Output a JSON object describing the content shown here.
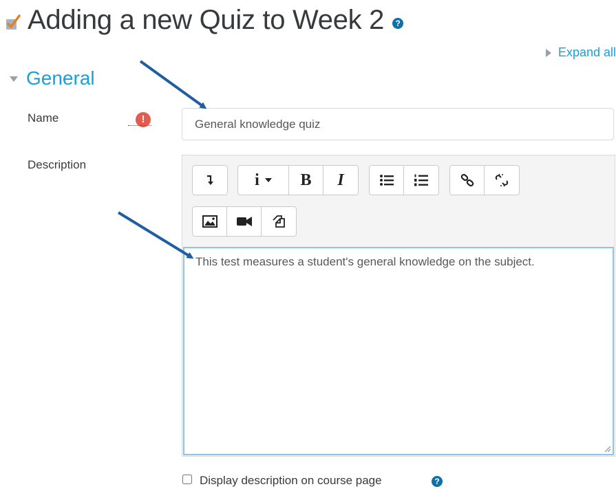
{
  "page": {
    "title": "Adding a new Quiz to Week 2",
    "expand_all": "Expand all"
  },
  "section": {
    "title": "General"
  },
  "form": {
    "name_label": "Name",
    "name_value": "General knowledge quiz",
    "description_label": "Description",
    "description_text": "This test measures a student's general knowledge on the subject.",
    "display_description_label": "Display description on course page",
    "display_description_checked": false
  },
  "toolbar": {
    "buttons": [
      "toggle-toolbar",
      "info",
      "bold",
      "italic",
      "unordered-list",
      "ordered-list",
      "link",
      "unlink",
      "image",
      "media",
      "manage-files"
    ],
    "bold_label": "B",
    "italic_label": "I",
    "info_label": "i"
  },
  "colors": {
    "accent": "#1a9fd8",
    "help": "#0f6fa6",
    "required": "#e55b4d",
    "arrow": "#1f5fa0"
  }
}
